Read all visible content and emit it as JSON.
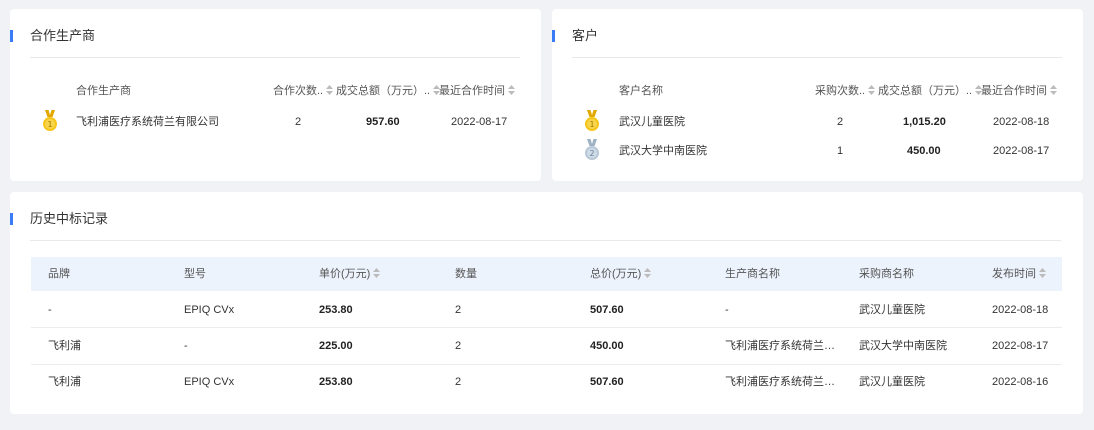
{
  "manufacturers": {
    "title": "合作生产商",
    "columns": [
      "合作生产商",
      "合作次数..",
      "成交总额（万元）..",
      "最近合作时间"
    ],
    "rows": [
      {
        "rank": "1",
        "name": "飞利浦医疗系统荷兰有限公司",
        "count": "2",
        "amount": "957.60",
        "date": "2022-08-17"
      }
    ]
  },
  "customers": {
    "title": "客户",
    "columns": [
      "客户名称",
      "采购次数..",
      "成交总额（万元）..",
      "最近合作时间"
    ],
    "rows": [
      {
        "rank": "1",
        "name": "武汉儿童医院",
        "count": "2",
        "amount": "1,015.20",
        "date": "2022-08-18"
      },
      {
        "rank": "2",
        "name": "武汉大学中南医院",
        "count": "1",
        "amount": "450.00",
        "date": "2022-08-17"
      }
    ]
  },
  "history": {
    "title": "历史中标记录",
    "columns": [
      "品牌",
      "型号",
      "单价(万元)",
      "数量",
      "总价(万元)",
      "生产商名称",
      "采购商名称",
      "发布时间"
    ],
    "rows": [
      [
        "-",
        "EPIQ CVx",
        "253.80",
        "2",
        "507.60",
        "-",
        "武汉儿童医院",
        "2022-08-18"
      ],
      [
        "飞利浦",
        "-",
        "225.00",
        "2",
        "450.00",
        "飞利浦医疗系统荷兰有限...",
        "武汉大学中南医院",
        "2022-08-17"
      ],
      [
        "飞利浦",
        "EPIQ CVx",
        "253.80",
        "2",
        "507.60",
        "飞利浦医疗系统荷兰有限...",
        "武汉儿童医院",
        "2022-08-16"
      ]
    ]
  },
  "colors": {
    "accent": "#3a7cf6",
    "gold_medal": "#f5c518",
    "silver_medal": "#b8c8d8",
    "header_bg": "#edf3fd"
  }
}
